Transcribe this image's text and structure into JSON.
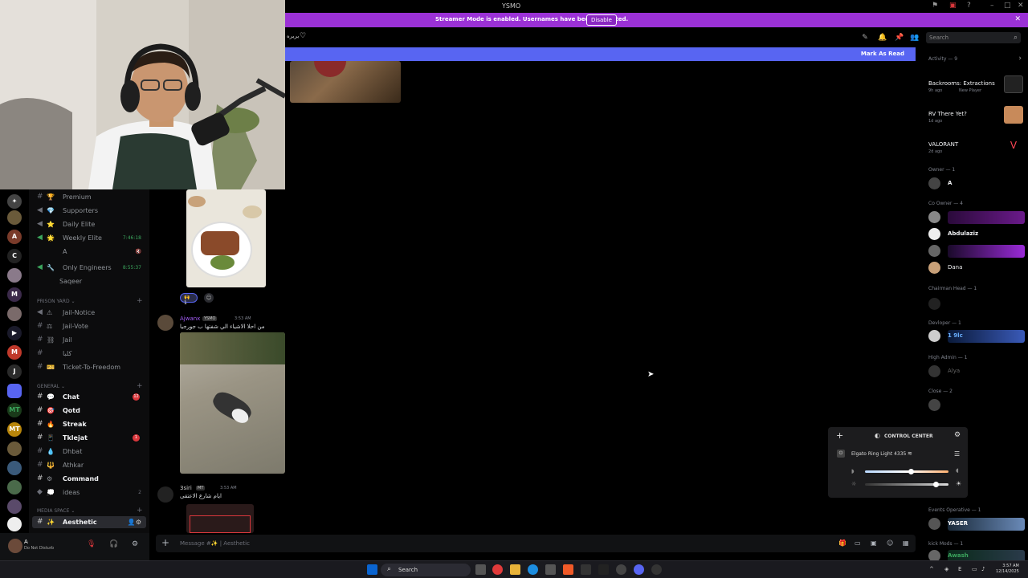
{
  "window": {
    "title": "YSMO"
  },
  "banner": {
    "message": "Streamer Mode is enabled. Usernames have been truncated.",
    "button": "Disable"
  },
  "header": {
    "search_placeholder": "Search",
    "channel_fragment": "بربره"
  },
  "new_messages": {
    "mark_as_read": "Mark As Read"
  },
  "channels": {
    "items": [
      {
        "emoji": "🏆",
        "label": "Premium"
      },
      {
        "emoji": "💎",
        "label": "Supporters"
      },
      {
        "emoji": "⭐",
        "label": "Daily Elite"
      },
      {
        "emoji": "🌟",
        "label": "Weekly Elite",
        "right": "7:46:18"
      },
      {
        "emoji": "",
        "label": "A"
      },
      {
        "emoji": "🔧",
        "label": "Only Engineers",
        "right": "8:55:37"
      },
      {
        "emoji": "",
        "label": "Saqeer"
      }
    ],
    "prison_category": "PRISON YARD",
    "prison": [
      {
        "emoji": "⚠",
        "label": "Jail-Notice"
      },
      {
        "emoji": "⚖",
        "label": "Jail-Vote"
      },
      {
        "emoji": "⛓",
        "label": "Jail"
      },
      {
        "emoji": "",
        "label": "كلبا"
      },
      {
        "emoji": "🎫",
        "label": "Ticket-To-Freedom"
      }
    ],
    "general_category": "GENERAL",
    "general": [
      {
        "emoji": "💬",
        "label": "Chat",
        "badge": "12"
      },
      {
        "emoji": "🎯",
        "label": "Qotd"
      },
      {
        "emoji": "🔥",
        "label": "Streak"
      },
      {
        "emoji": "📱",
        "label": "Tklejat",
        "badge": "1"
      },
      {
        "emoji": "💧",
        "label": "Dhbat"
      },
      {
        "emoji": "🔱",
        "label": "Athkar"
      },
      {
        "emoji": "⚙",
        "label": "Command"
      },
      {
        "emoji": "💭",
        "label": "ideas",
        "right": "2"
      }
    ],
    "media_category": "MEDIA SPACE",
    "media": [
      {
        "emoji": "✨",
        "label": "Aesthetic"
      }
    ]
  },
  "user": {
    "name": "A",
    "status": "Do Not Disturb"
  },
  "messages": [
    {
      "author": "Ajwanx",
      "tag": "YSMO",
      "time": "3:53 AM",
      "text": "من احلا الاشياء الي شفتها ب جورجيا"
    },
    {
      "author": "3siri",
      "tag": "MT",
      "time": "3:53 AM",
      "text": "ايام شارع الاعتقى"
    }
  ],
  "reaction": {
    "count": "1"
  },
  "composer": {
    "placeholder": "Message #✨ | Aesthetic"
  },
  "members": {
    "activity_header": "Activity — 9",
    "activities": [
      {
        "name": "Backrooms: Extractions",
        "time": "9h ago",
        "note": "New Player"
      },
      {
        "name": "RV There Yet?",
        "time": "1d ago"
      },
      {
        "name": "VALORANT",
        "time": "2d ago"
      }
    ],
    "owner_header": "Owner — 1",
    "owner": "A",
    "coowner_header": "Co Owner — 4",
    "coowners": [
      "Abdulaziz",
      "Dana"
    ],
    "chairman_header": "Chairman Head — 1",
    "developer_header": "Devloper — 1",
    "developer": "1 9lc",
    "highadmin_header": "High Admin — 1",
    "highadmin": "Alya",
    "close_header": "Close — 2",
    "events_header": "Events Operative — 1",
    "events_member": "YASER",
    "kick_header": "kick Mods — 1",
    "kick_member": "Awash"
  },
  "control_center": {
    "title": "CONTROL CENTER",
    "device": "Elgato Ring Light 4335",
    "brightness": 0.55,
    "temperature": 0.85
  },
  "taskbar": {
    "search": "Search",
    "time": "3:57 AM",
    "date": "12/14/2025"
  }
}
